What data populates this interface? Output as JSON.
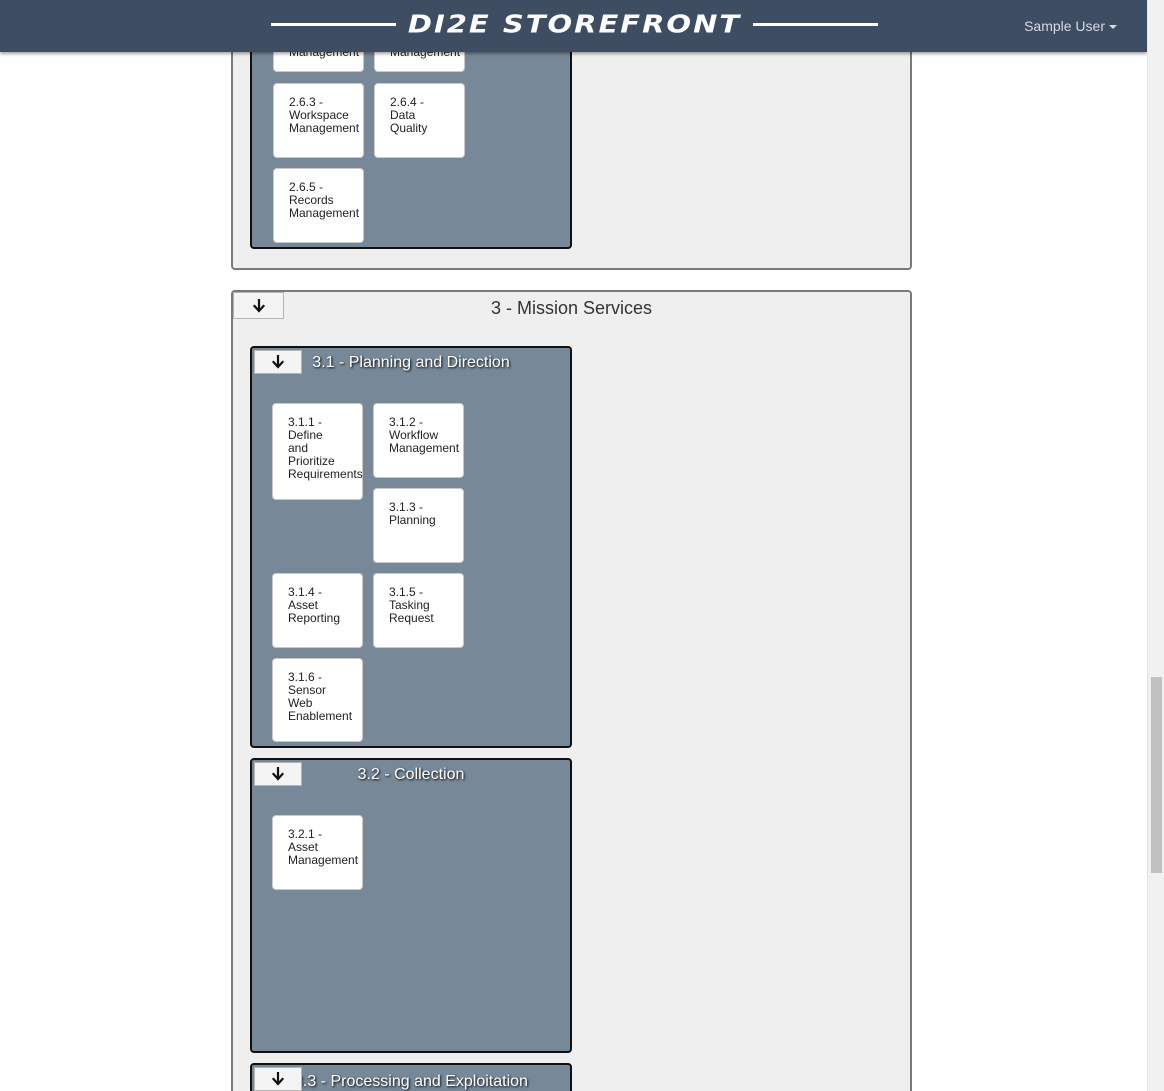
{
  "header": {
    "brand": "DI2E STOREFRONT",
    "user_label": "Sample User"
  },
  "category2": {
    "tiles_top_partial": [
      "Management",
      "Management"
    ],
    "tiles": [
      "2.6.3 -\nWorkspace\nManagement",
      "2.6.4 -\nData\nQuality",
      "2.6.5 -\nRecords\nManagement"
    ]
  },
  "category3": {
    "title": "3 - Mission Services",
    "groups": [
      {
        "title": "3.1 - Planning and Direction",
        "tiles": [
          "3.1.1 -\nDefine\nand\nPrioritize\nRequirements",
          "3.1.2 -\nWorkflow\nManagement",
          "3.1.3 -\nPlanning",
          "3.1.4 -\nAsset\nReporting",
          "3.1.5 -\nTasking\nRequest",
          "3.1.6 -\nSensor\nWeb\nEnablement"
        ]
      },
      {
        "title": "3.2 - Collection",
        "tiles": [
          "3.2.1 -\nAsset\nManagement"
        ]
      },
      {
        "title": "3.3 - Processing and Exploitation",
        "tiles": []
      }
    ]
  },
  "icons": {
    "toggle": "arrow-down-icon",
    "caret": "caret-down-icon"
  },
  "colors": {
    "navbar": "#3f4d63",
    "group_bg": "#778899",
    "category_bg": "#efefef"
  }
}
